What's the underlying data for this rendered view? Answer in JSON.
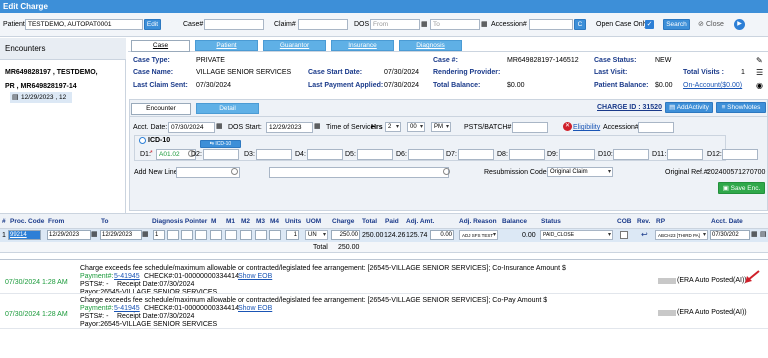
{
  "window": {
    "title": "Edit Charge"
  },
  "search": {
    "patient_label": "Patient",
    "patient_value": "TESTDEMO, AUTOPAT0001",
    "edit_label": "Edit",
    "case_label": "Case#",
    "claim_label": "Claim#",
    "dos_label": "DOS",
    "from_placeholder": "From",
    "to_placeholder": "To",
    "accession_label": "Accession#",
    "c_label": "C",
    "open_case_label": "Open Case Only",
    "search_label": "Search",
    "close_label": "Close"
  },
  "sidebar": {
    "title": "Encounters",
    "patient_line": "MR649828197 , TESTDEMO,",
    "pr_line": "PR , MR649828197-14",
    "encounter_item": "12/29/2023 , 12"
  },
  "case_tabs": [
    "Case",
    "Patient",
    "Guarantor",
    "Insurance",
    "Diagnosis"
  ],
  "case_info": {
    "case_type_label": "Case Type:",
    "case_type": "PRIVATE",
    "case_no_label": "Case #:",
    "case_no": "MR649828197-146512",
    "case_status_label": "Case Status:",
    "case_status": "NEW",
    "case_name_label": "Case Name:",
    "case_name": "VILLAGE SENIOR SERVICES",
    "case_start_label": "Case Start Date:",
    "case_start": "07/30/2024",
    "rendering_label": "Rendering Provider:",
    "rendering": "",
    "last_visit_label": "Last Visit:",
    "last_visit": "",
    "total_visits_label": "Total Visits :",
    "total_visits": "1",
    "last_claim_label": "Last Claim Sent:",
    "last_claim": "07/30/2024",
    "last_payment_label": "Last Payment Applied:",
    "last_payment": "07/30/2024",
    "total_balance_label": "Total Balance:",
    "total_balance": "$0.00",
    "patient_balance_label": "Patient Balance:",
    "patient_balance": "$0.00",
    "on_account": "On-Account($0.00)"
  },
  "encounter": {
    "tabs": [
      "Encounter",
      "Detail"
    ],
    "charge_id": "CHARGE ID : 31520",
    "add_activity": "AddActivity",
    "show_notes": "ShowNotes",
    "acct_date_label": "Acct. Date:",
    "acct_date": "07/30/2024",
    "dos_start_label": "DOS Start:",
    "dos_start": "12/29/2023",
    "time_label": "Time of Service",
    "hrs_label": "Hrs",
    "hrs": "2",
    "mins": "00",
    "ampm": "PM",
    "psts_label": "PSTS/BATCH#",
    "psts": "",
    "eligibility": "Eligibility",
    "accession_label": "Accession#",
    "icd_label": "ICD-10",
    "icd_lookup": "ICD-10 Lookup",
    "d_labels": [
      "D1:",
      "D2:",
      "D3:",
      "D4:",
      "D5:",
      "D6:",
      "D7:",
      "D8:",
      "D9:",
      "D10:",
      "D11:",
      "D12:"
    ],
    "d1_value": "A01.02",
    "add_new_line": "Add New Line",
    "resub_label": "Resubmission Code",
    "resub_value": "Original Claim",
    "orig_ref_label": "Original Ref.#:",
    "orig_ref": "202400571270700",
    "save_enc": "Save Enc."
  },
  "grid": {
    "headers": [
      "#",
      "Proc. Code",
      "From",
      "To",
      "Diagnosis Pointer",
      "M",
      "M1",
      "M2",
      "M3",
      "M4",
      "Units",
      "UOM",
      "Charge",
      "Total",
      "Paid",
      "Adj. Amt.",
      "Adj. Reason",
      "Balance",
      "Status",
      "COB",
      "Rev.",
      "RP",
      "Acct. Date"
    ],
    "row": {
      "num": "1",
      "proc": "99214",
      "from": "12/29/2023",
      "to": "12/29/2023",
      "dx1": "1",
      "units": "1",
      "uom": "UN",
      "charge": "250.00",
      "total": "250.00",
      "paid": "124.26",
      "adj": "125.74",
      "adj_val": "0.00",
      "adj_reason": "ADJ SFS TEST",
      "balance": "0.00",
      "status": "PAID_CLOSE",
      "rp": "ABCH23 [THIRD PA]",
      "acct_date": "07/30/202"
    },
    "total_label": "Total",
    "total_value": "250.00"
  },
  "notes": [
    {
      "date": "07/30/2024 1:28 AM",
      "text": "Charge exceeds fee schedule/maximum allowable or contracted/legislated fee arrangement: [26545-VILLAGE SENIOR SERVICES]; Co-Insurance Amount $",
      "payment_label": "Payment#:",
      "payment_no": "5-41945",
      "check": "CHECK#:01-00000000334414",
      "show_eob": "Show EOB",
      "psts": "PSTS#: -",
      "receipt": "Receipt Date:07/30/2024",
      "payor": "Payor:26545-VILLAGE SENIOR SERVICES",
      "right": "(ERA Auto Posted(AI))"
    },
    {
      "date": "07/30/2024 1:28 AM",
      "text": "Charge exceeds fee schedule/maximum allowable or contracted/legislated fee arrangement: [26545-VILLAGE SENIOR SERVICES]; Co-Pay Amount $",
      "payment_label": "Payment#:",
      "payment_no": "5-41945",
      "check": "CHECK#:01-00000000334414",
      "show_eob": "Show EOB",
      "psts": "PSTS#: -",
      "receipt": "Receipt Date:07/30/2024",
      "payor": "Payor:26545-VILLAGE SENIOR SERVICES",
      "right": "(ERA Auto Posted(AI))"
    }
  ],
  "colors": {
    "title_bar": "#3d8fd8",
    "tab_blue": "#5fb0e6",
    "header_blue": "#1a3a8a",
    "arrow": "#d0202a"
  }
}
